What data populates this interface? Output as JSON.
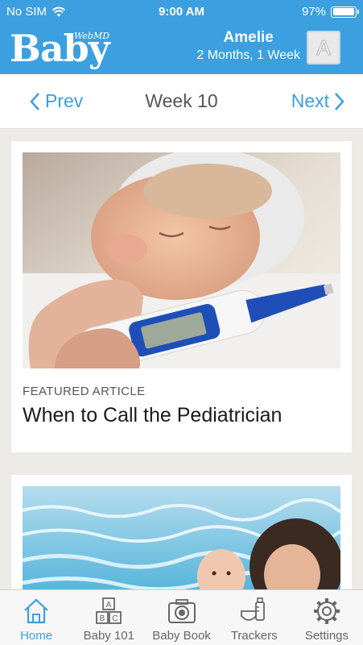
{
  "status": {
    "carrier": "No SIM",
    "time": "9:00 AM",
    "battery": "97%",
    "battery_level": 0.97
  },
  "header": {
    "logo_text": "Baby",
    "logo_brand": "WebMD",
    "child_name": "Amelie",
    "child_age": "2 Months, 1 Week",
    "avatar_letter": "A",
    "color": "#3b9fe0"
  },
  "week_nav": {
    "prev_label": "Prev",
    "title": "Week 10",
    "next_label": "Next"
  },
  "cards": [
    {
      "label": "FEATURED ARTICLE",
      "title": "When to Call the Pediatrician",
      "image": "sick-baby-thermometer-photo"
    },
    {
      "image": "baby-swimming-pool-photo"
    }
  ],
  "tabs": [
    {
      "label": "Home",
      "icon": "home-icon",
      "active": true
    },
    {
      "label": "Baby 101",
      "icon": "abc-blocks-icon",
      "active": false
    },
    {
      "label": "Baby Book",
      "icon": "camera-icon",
      "active": false
    },
    {
      "label": "Trackers",
      "icon": "bottle-diaper-icon",
      "active": false
    },
    {
      "label": "Settings",
      "icon": "gear-icon",
      "active": false
    }
  ]
}
